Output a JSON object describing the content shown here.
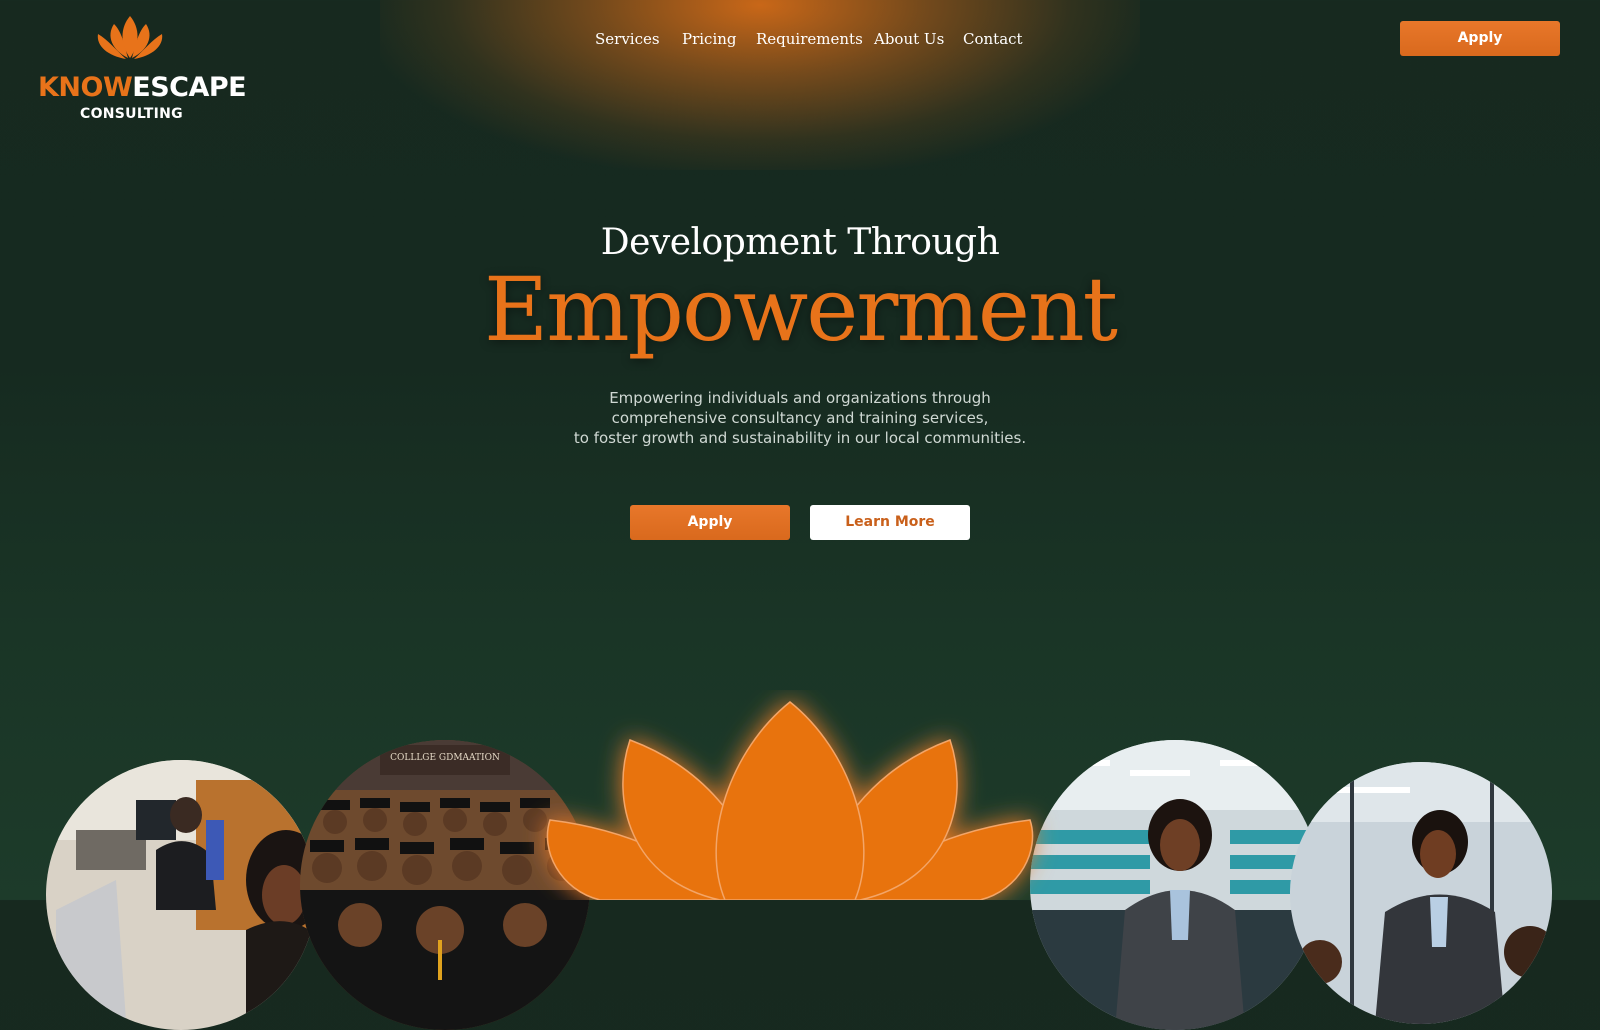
{
  "brand": {
    "name_part1": "KNOW",
    "name_part2": "ESCAPE",
    "subtitle": "CONSULTING",
    "icon": "lotus-icon",
    "colors": {
      "accent": "#e8731a",
      "background": "#17291f",
      "text": "#ffffff"
    }
  },
  "nav": {
    "items": [
      {
        "label": "Services"
      },
      {
        "label": "Pricing"
      },
      {
        "label": "Requirements"
      },
      {
        "label": "About Us"
      },
      {
        "label": "Contact"
      }
    ],
    "apply_label": "Apply"
  },
  "hero": {
    "heading_line1": "Development Through",
    "heading_line2": "Empowerment",
    "tagline_lines": [
      "Empowering individuals and organizations through",
      "comprehensive consultancy and training services,",
      "to foster growth and sustainability in our local communities."
    ],
    "apply_label": "Apply",
    "learn_more_label": "Learn More"
  },
  "photos": [
    {
      "name": "photo-students-laptop"
    },
    {
      "name": "photo-graduation-ceremony",
      "sign_text": "COLLLGE GDMAATION"
    },
    {
      "name": "photo-woman-office"
    },
    {
      "name": "photo-woman-suit"
    }
  ]
}
